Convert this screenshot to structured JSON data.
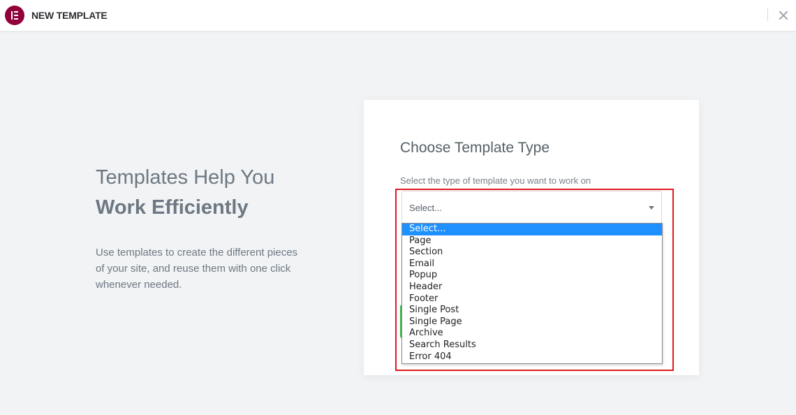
{
  "header": {
    "title": "NEW TEMPLATE",
    "logo_color": "#92003b"
  },
  "intro": {
    "line1": "Templates Help You",
    "line2": "Work Efficiently",
    "description": "Use templates to create the different pieces of your site, and reuse them with one click whenever needed."
  },
  "form": {
    "title": "Choose Template Type",
    "type_label": "Select the type of template you want to work on",
    "select_value": "Select...",
    "options": [
      "Select...",
      "Page",
      "Section",
      "Email",
      "Popup",
      "Header",
      "Footer",
      "Single Post",
      "Single Page",
      "Archive",
      "Search Results",
      "Error 404"
    ],
    "selected_index": 0
  },
  "colors": {
    "highlight": "#e0181f",
    "selected_option_bg": "#1e90ff",
    "create_button": "#39b54a"
  }
}
